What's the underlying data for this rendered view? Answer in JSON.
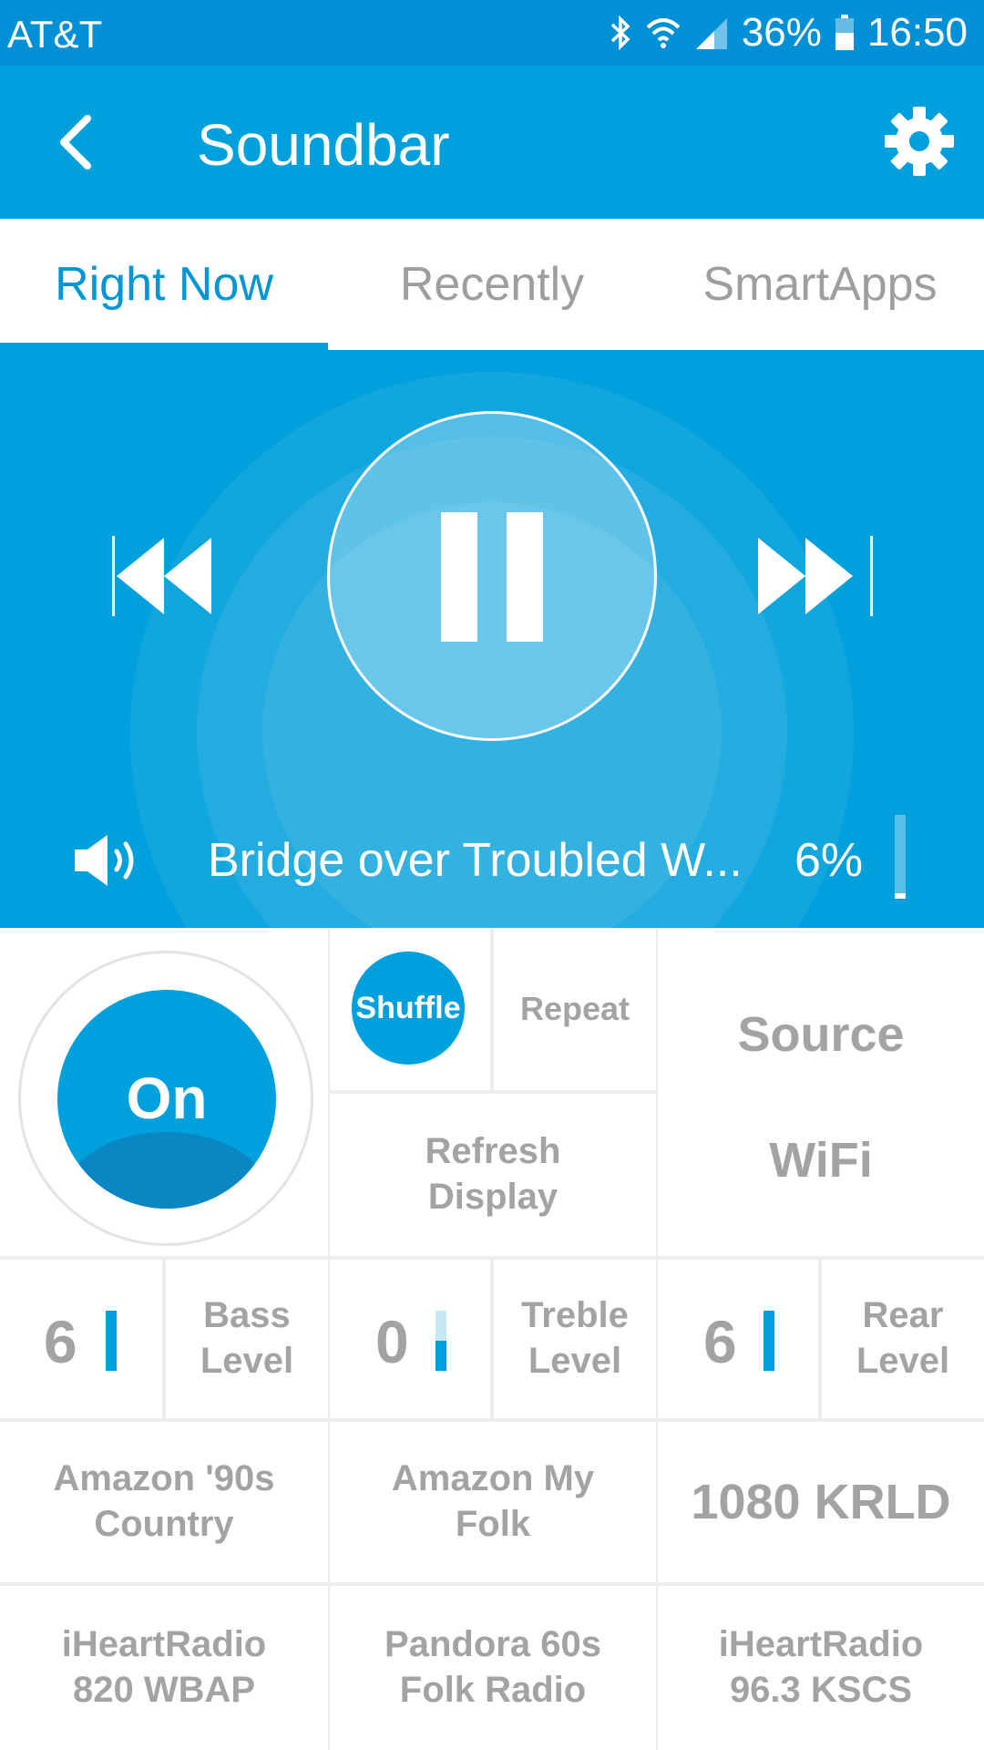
{
  "status_bar": {
    "carrier": "AT&T",
    "battery_percent": "36%",
    "time": "16:50",
    "icons": [
      "bluetooth-icon",
      "wifi-icon",
      "signal-icon",
      "battery-icon"
    ]
  },
  "app_bar": {
    "title": "Soundbar",
    "back_icon": "chevron-left-icon",
    "settings_icon": "gear-icon"
  },
  "tabs": [
    {
      "label": "Right Now",
      "active": true
    },
    {
      "label": "Recently",
      "active": false
    },
    {
      "label": "SmartApps",
      "active": false
    }
  ],
  "player": {
    "state": "playing",
    "track": "Bridge over Troubled W...",
    "volume_label": "6%",
    "volume_level": 0.06
  },
  "controls": {
    "power_label": "On",
    "shuffle_label": "Shuffle",
    "repeat_label": "Repeat",
    "refresh_label": "Refresh\nDisplay",
    "source_label": "Source",
    "source_value": "WiFi"
  },
  "levels": [
    {
      "value": "6",
      "label": "Bass\nLevel",
      "level": 1.0
    },
    {
      "value": "0",
      "label": "Treble\nLevel",
      "level": 0.5
    },
    {
      "value": "6",
      "label": "Rear\nLevel",
      "level": 1.0
    }
  ],
  "presets": [
    "Amazon '90s\nCountry",
    "Amazon My\nFolk",
    "1080 KRLD",
    "iHeartRadio\n820 WBAP",
    "Pandora 60s\nFolk Radio",
    "iHeartRadio\n96.3 KSCS"
  ],
  "colors": {
    "status_bar": "#0090d5",
    "accent": "#00a0dc",
    "muted_text": "#a3a3a6"
  }
}
